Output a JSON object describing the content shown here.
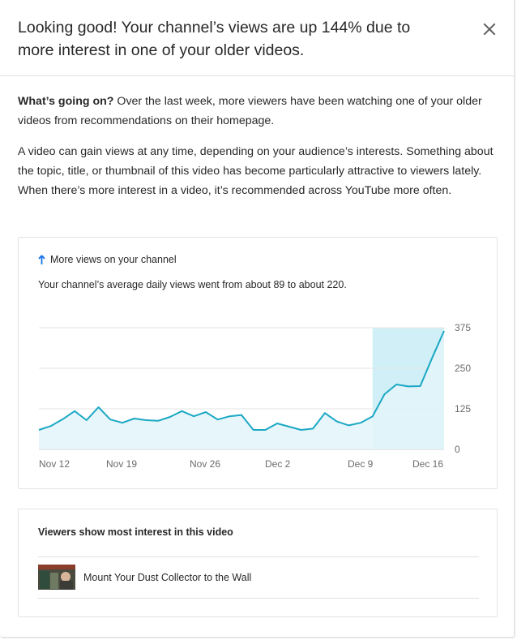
{
  "dialog": {
    "title": "Looking good! Your channel’s views are up 144% due to more interest in one of your older videos.",
    "close_icon": "close-icon"
  },
  "explanation": {
    "heading": "What’s going on?",
    "paragraph1": " Over the last week, more viewers have been watching one of your older videos from recommendations on their homepage.",
    "paragraph2": "A video can gain views at any time, depending on your audience’s interests. Something about the topic, title, or thumbnail of this video has become particularly attractive to viewers lately. When there’s more interest in a video, it’s recommended across YouTube more often."
  },
  "views_card": {
    "title": "More views on your channel",
    "icon": "arrow-up-icon",
    "subtitle": "Your channel’s average daily views went from about 89 to about 220."
  },
  "chart_data": {
    "type": "area",
    "title": "",
    "xlabel": "",
    "ylabel": "",
    "x_tick_labels": [
      "Nov 12",
      "Nov 19",
      "Nov 26",
      "Dec 2",
      "Dec 9",
      "Dec 16"
    ],
    "y_ticks": [
      0,
      125,
      250,
      375
    ],
    "ylim": [
      0,
      375
    ],
    "highlight_range": "last week",
    "colors": {
      "line": "#1ba8c4",
      "fill": "#e3f4fa",
      "highlight_fill": "#c8ecf5",
      "grid": "#e4e4e4"
    },
    "grid": true,
    "values": [
      60,
      72,
      93,
      118,
      90,
      130,
      92,
      82,
      95,
      90,
      88,
      100,
      118,
      102,
      115,
      92,
      102,
      106,
      60,
      60,
      80,
      70,
      60,
      64,
      112,
      86,
      74,
      82,
      102,
      170,
      200,
      194,
      195,
      282,
      365
    ]
  },
  "viewers_card": {
    "title": "Viewers show most interest in this video",
    "video": {
      "title": "Mount Your Dust Collector to the Wall"
    }
  }
}
